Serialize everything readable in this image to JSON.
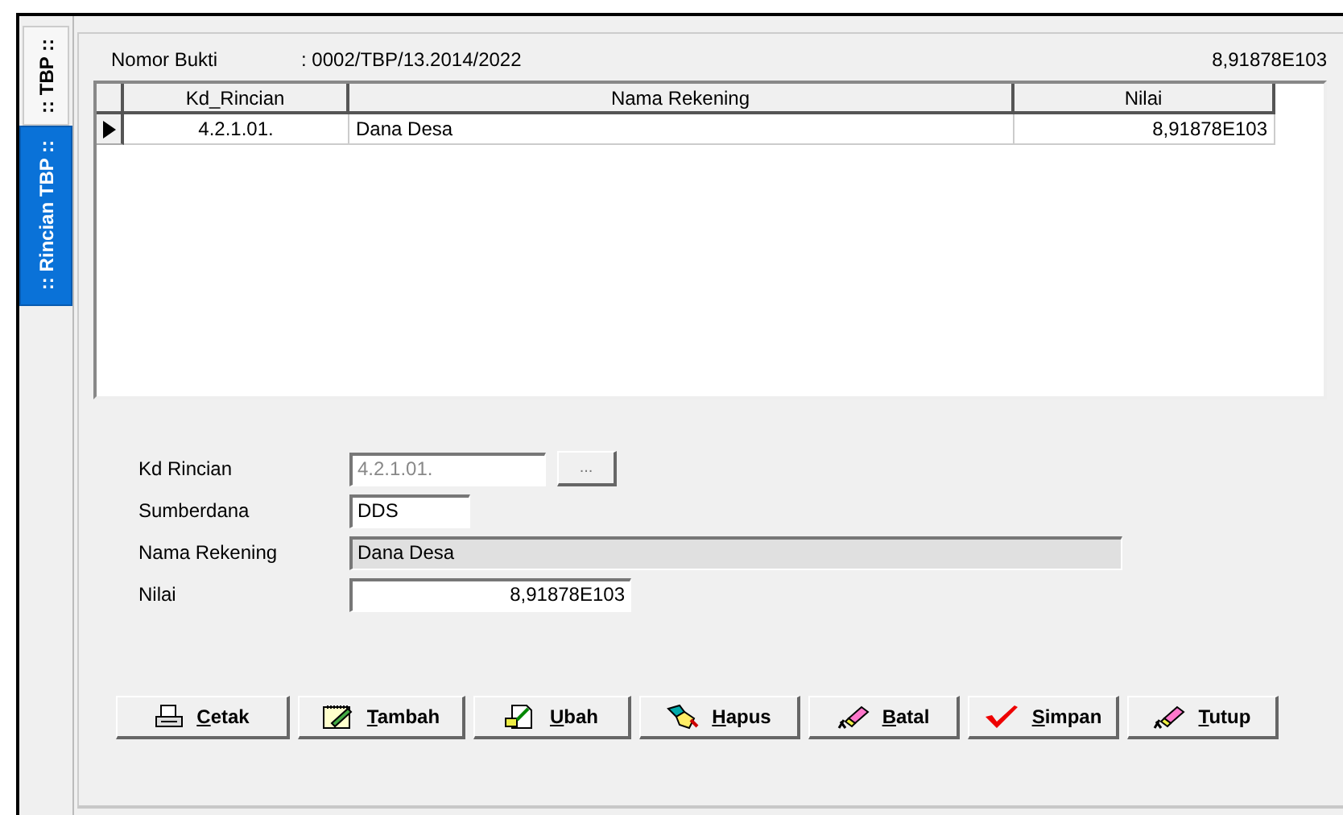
{
  "side_tabs": [
    {
      "label": ":: TBP ::",
      "selected": false
    },
    {
      "label": ":: Rincian TBP ::",
      "selected": true
    }
  ],
  "header": {
    "label": "Nomor Bukti",
    "value": ": 0002/TBP/13.2014/2022",
    "total": "8,91878E103"
  },
  "table": {
    "columns": [
      "Kd_Rincian",
      "Nama Rekening",
      "Nilai"
    ],
    "rows": [
      {
        "cells": [
          "4.2.1.01.",
          "Dana Desa",
          "8,91878E103"
        ],
        "selected": true
      }
    ]
  },
  "form": [
    {
      "kind": "lookup",
      "label": "Kd Rincian",
      "value": "4.2.1.01.",
      "button": "...",
      "disabled": true
    },
    {
      "kind": "short",
      "label": "Sumberdana",
      "value": "DDS",
      "disabled": false
    },
    {
      "kind": "wide",
      "label": "Nama Rekening",
      "value": "Dana Desa",
      "disabled": true
    },
    {
      "kind": "number",
      "label": "Nilai",
      "value": "8,91878E103",
      "disabled": false
    }
  ],
  "buttons": [
    {
      "label": "Cetak",
      "kind": "print"
    },
    {
      "label": "Tambah",
      "kind": "add"
    },
    {
      "label": "Ubah",
      "kind": "edit"
    },
    {
      "label": "Hapus",
      "kind": "delete"
    },
    {
      "label": "Batal",
      "kind": "cancel"
    },
    {
      "label": "Simpan",
      "kind": "save"
    },
    {
      "label": "Tutup",
      "kind": "close"
    }
  ]
}
